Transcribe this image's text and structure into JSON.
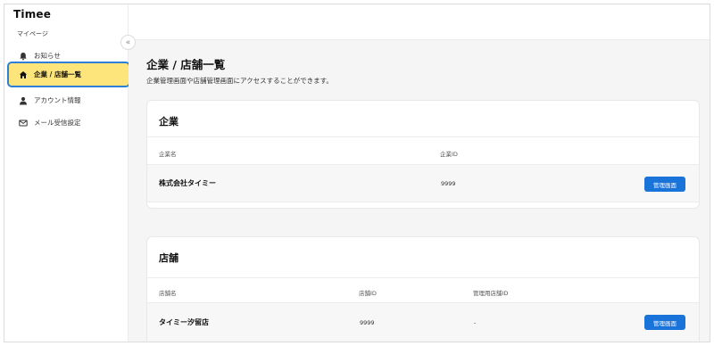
{
  "app": {
    "logo": "Timee"
  },
  "sidebar": {
    "section_label": "マイページ",
    "items": [
      {
        "label": "お知らせ",
        "icon": "bell-icon"
      },
      {
        "label": "企業 / 店舗一覧",
        "icon": "home-icon",
        "active": true
      },
      {
        "label": "アカウント情報",
        "icon": "person-icon"
      },
      {
        "label": "メール受信設定",
        "icon": "mail-icon"
      }
    ],
    "collapse_glyph": "«"
  },
  "main": {
    "title": "企業 / 店舗一覧",
    "description": "企業管理画面や店舗管理画面にアクセスすることができます。",
    "company_card": {
      "title": "企業",
      "columns": [
        "企業名",
        "企業ID"
      ],
      "rows": [
        {
          "name": "株式会社タイミー",
          "id": "9999",
          "button": "管理画面"
        }
      ]
    },
    "store_card": {
      "title": "店舗",
      "columns": [
        "店舗名",
        "店舗ID",
        "管理用店舗ID"
      ],
      "rows": [
        {
          "name": "タイミー汐留店",
          "id": "9999",
          "admin_id": "-",
          "button": "管理画面"
        }
      ]
    }
  },
  "colors": {
    "accent_blue": "#1a73d9",
    "active_yellow": "#fde47b",
    "active_border": "#2f7fd6",
    "background": "#f5f5f5"
  }
}
